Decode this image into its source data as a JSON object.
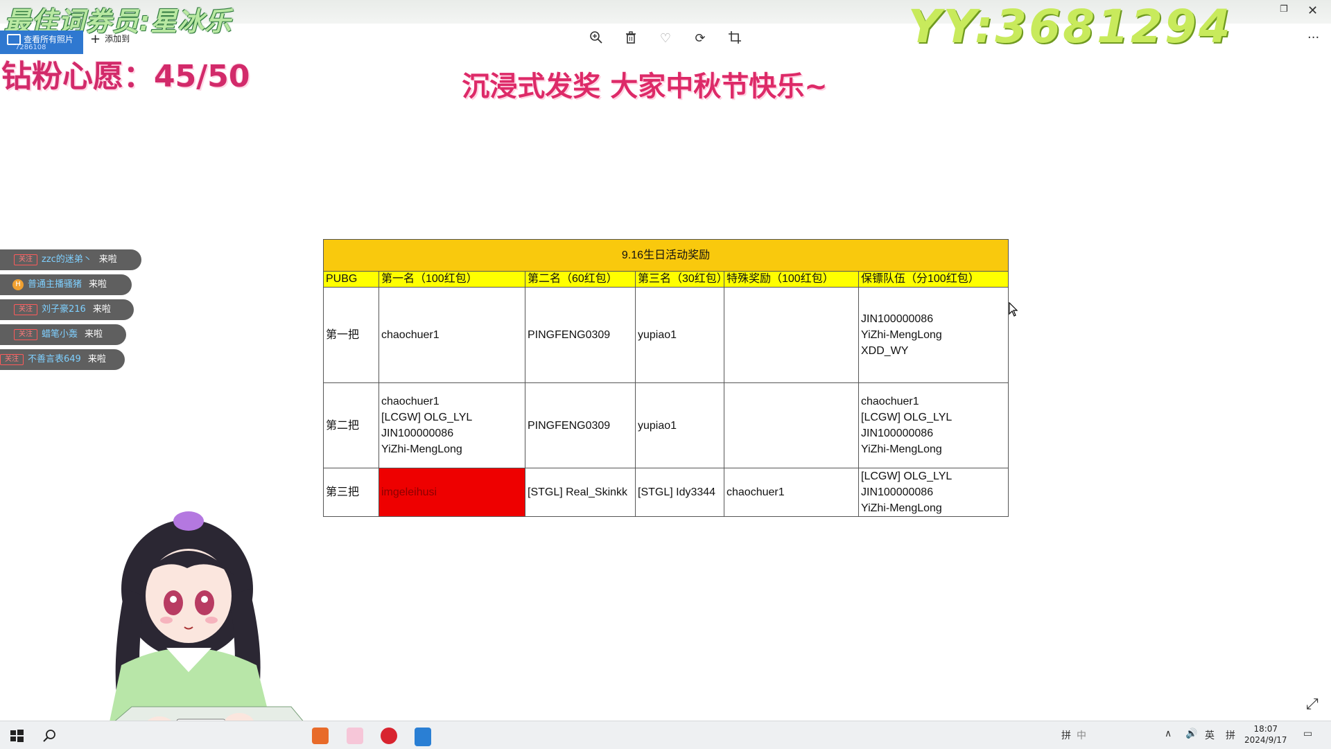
{
  "overlays": {
    "top_left": "最佳词券员:星冰乐",
    "top_right": "YY:3681294",
    "diamond_wish": "钻粉心愿：45/50",
    "headline": "沉浸式发奖 大家中秋节快乐~"
  },
  "photo_toolbar": {
    "view_all_label": "查看所有照片",
    "view_all_sub": "7286108",
    "add_to_label": "添加到",
    "tools": [
      "zoom-in-icon",
      "delete-icon",
      "favorite-icon",
      "rotate-icon",
      "crop-icon"
    ],
    "more_label": "···"
  },
  "chat": [
    {
      "badge": "关注",
      "user": "zzc的迷弟丶",
      "text": "来啦"
    },
    {
      "badge": "H",
      "user": "普通主播骚猪",
      "text": "来啦"
    },
    {
      "badge": "关注",
      "user": "刘子豪216",
      "text": "来啦"
    },
    {
      "badge": "关注",
      "user": "蜡笔小轰",
      "text": "来啦"
    },
    {
      "badge": "关注",
      "user": "不善言表649",
      "text": "来啦"
    }
  ],
  "sheet": {
    "title": "9.16生日活动奖励",
    "headers": [
      "PUBG",
      "第一名（100红包）",
      "第二名（60红包）",
      "第三名（30红包）",
      "特殊奖励（100红包）",
      "保镖队伍（分100红包）"
    ],
    "rows": [
      {
        "label": "第一把",
        "first": [
          "chaochuer1"
        ],
        "second": [
          "PINGFENG0309"
        ],
        "third": [
          "yupiao1"
        ],
        "special": [],
        "guard": [
          "JIN100000086",
          "YiZhi-MengLong",
          "XDD_WY"
        ]
      },
      {
        "label": "第二把",
        "first": [
          "chaochuer1",
          "[LCGW] OLG_LYL",
          "JIN100000086",
          "YiZhi-MengLong"
        ],
        "second": [
          "PINGFENG0309"
        ],
        "third": [
          "yupiao1"
        ],
        "special": [],
        "guard": [
          "chaochuer1",
          "[LCGW] OLG_LYL",
          "JIN100000086",
          "YiZhi-MengLong"
        ]
      },
      {
        "label": "第三把",
        "first": [
          "imgeleihusi"
        ],
        "second": [
          "[STGL] Real_Skinkk"
        ],
        "third": [
          "[STGL] Idy3344"
        ],
        "special": [
          "chaochuer1"
        ],
        "guard": [
          "[LCGW] OLG_LYL",
          "JIN100000086",
          "YiZhi-MengLong"
        ]
      }
    ],
    "highlight_color": "#ee0000",
    "title_color": "#f9c90d",
    "header_color": "#ffff00"
  },
  "taskbar": {
    "apps": [
      "start-icon",
      "search-icon",
      "avatar-app-icon",
      "anime-app-icon",
      "netease-music-icon",
      "photos-app-icon"
    ],
    "tray": [
      "拼",
      "中",
      "英",
      "拼"
    ],
    "time": "18:07",
    "date": "2024/9/17"
  }
}
